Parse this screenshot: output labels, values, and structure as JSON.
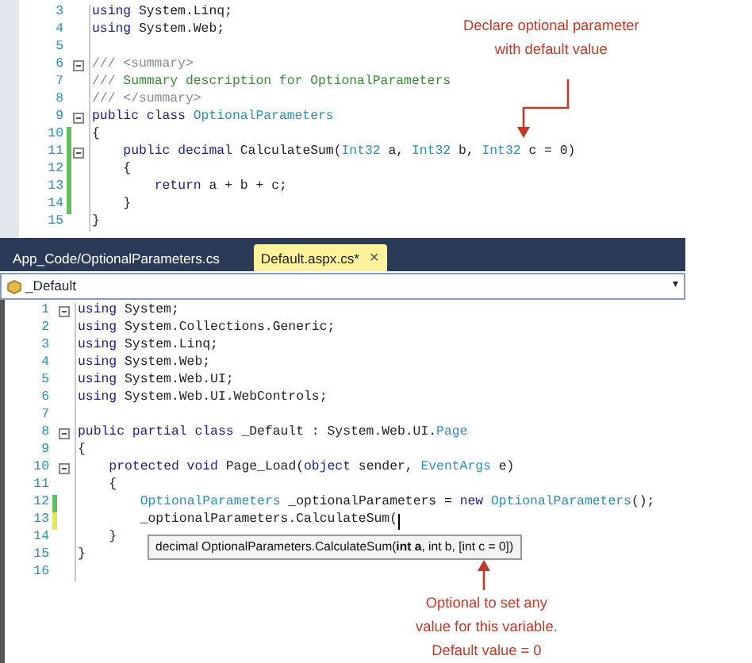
{
  "top_editor": {
    "lines": [
      {
        "number": "3",
        "segments": [
          {
            "kind": "kw",
            "text": "using"
          },
          {
            "kind": "plain",
            "text": " System.Linq;"
          }
        ]
      },
      {
        "number": "4",
        "segments": [
          {
            "kind": "kw",
            "text": "using"
          },
          {
            "kind": "plain",
            "text": " System.Web;"
          }
        ]
      },
      {
        "number": "5"
      },
      {
        "number": "6",
        "fold": true,
        "segments": [
          {
            "kind": "doc",
            "text": "/// <summary>"
          }
        ]
      },
      {
        "number": "7",
        "segments": [
          {
            "kind": "doc",
            "text": "///"
          },
          {
            "kind": "comment",
            "text": " Summary description for OptionalParameters"
          }
        ]
      },
      {
        "number": "8",
        "segments": [
          {
            "kind": "doc",
            "text": "/// </summary>"
          }
        ]
      },
      {
        "number": "9",
        "fold": true,
        "segments": [
          {
            "kind": "kw",
            "text": "public class"
          },
          {
            "kind": "type",
            "text": " OptionalParameters"
          }
        ]
      },
      {
        "number": "10",
        "modified": true,
        "saved": true,
        "segments": [
          {
            "kind": "plain",
            "text": "{"
          }
        ]
      },
      {
        "number": "11",
        "modified": true,
        "saved": true,
        "fold": true,
        "indented": true,
        "segments": [
          {
            "kind": "kw",
            "text": "public decimal"
          },
          {
            "kind": "plain",
            "text": " CalculateSum("
          },
          {
            "kind": "type",
            "text": "Int32"
          },
          {
            "kind": "plain",
            "text": " a, "
          },
          {
            "kind": "type",
            "text": "Int32"
          },
          {
            "kind": "plain",
            "text": " b, "
          },
          {
            "kind": "type",
            "text": "Int32"
          },
          {
            "kind": "plain",
            "text": " c = 0)"
          }
        ]
      },
      {
        "number": "12",
        "modified": true,
        "saved": true,
        "indented": true,
        "segments": [
          {
            "kind": "plain",
            "text": "{"
          }
        ]
      },
      {
        "number": "13",
        "modified": true,
        "saved": true,
        "indented": true,
        "deeper": true,
        "segments": [
          {
            "kind": "kw",
            "text": "return"
          },
          {
            "kind": "plain",
            "text": " a + b + c;"
          }
        ]
      },
      {
        "number": "14",
        "modified": true,
        "saved": true,
        "indented": true,
        "segments": [
          {
            "kind": "plain",
            "text": "}"
          }
        ]
      },
      {
        "number": "15",
        "segments": [
          {
            "kind": "plain",
            "text": "}"
          }
        ]
      }
    ]
  },
  "tabs": [
    {
      "label": "App_Code/OptionalParameters.cs",
      "selected": false
    },
    {
      "label": "Default.aspx.cs*",
      "selected": true,
      "close": "✕"
    }
  ],
  "member_dropdown": {
    "value": "_Default",
    "caret": "▾"
  },
  "bottom_editor": {
    "lines": [
      {
        "number": "1",
        "fold": true,
        "segments": [
          {
            "kind": "kw",
            "text": "using"
          },
          {
            "kind": "plain",
            "text": " System;"
          }
        ]
      },
      {
        "number": "2",
        "segments": [
          {
            "kind": "kw",
            "text": "using"
          },
          {
            "kind": "plain",
            "text": " System.Collections.Generic;"
          }
        ]
      },
      {
        "number": "3",
        "segments": [
          {
            "kind": "kw",
            "text": "using"
          },
          {
            "kind": "plain",
            "text": " System.Linq;"
          }
        ]
      },
      {
        "number": "4",
        "segments": [
          {
            "kind": "kw",
            "text": "using"
          },
          {
            "kind": "plain",
            "text": " System.Web;"
          }
        ]
      },
      {
        "number": "5",
        "segments": [
          {
            "kind": "kw",
            "text": "using"
          },
          {
            "kind": "plain",
            "text": " System.Web.UI;"
          }
        ]
      },
      {
        "number": "6",
        "segments": [
          {
            "kind": "kw",
            "text": "using"
          },
          {
            "kind": "plain",
            "text": " System.Web.UI.WebControls;"
          }
        ]
      },
      {
        "number": "7"
      },
      {
        "number": "8",
        "fold": true,
        "segments": [
          {
            "kind": "kw",
            "text": "public partial class"
          },
          {
            "kind": "plain",
            "text": " _Default : System.Web.UI."
          },
          {
            "kind": "type",
            "text": "Page"
          }
        ]
      },
      {
        "number": "9",
        "segments": [
          {
            "kind": "plain",
            "text": "{"
          }
        ]
      },
      {
        "number": "10",
        "fold": true,
        "indented": true,
        "segments": [
          {
            "kind": "kw",
            "text": "protected void"
          },
          {
            "kind": "plain",
            "text": " Page_Load("
          },
          {
            "kind": "kw",
            "text": "object"
          },
          {
            "kind": "plain",
            "text": " sender, "
          },
          {
            "kind": "type",
            "text": "EventArgs"
          },
          {
            "kind": "plain",
            "text": " e)"
          }
        ]
      },
      {
        "number": "11",
        "indented": true,
        "segments": [
          {
            "kind": "plain",
            "text": "{"
          }
        ]
      },
      {
        "number": "12",
        "modified": true,
        "saved": true,
        "indented": true,
        "deeper": true,
        "segments": [
          {
            "kind": "type",
            "text": "OptionalParameters"
          },
          {
            "kind": "plain",
            "text": " _optionalParameters = "
          },
          {
            "kind": "kw",
            "text": "new"
          },
          {
            "kind": "type",
            "text": " OptionalParameters"
          },
          {
            "kind": "plain",
            "text": "();"
          }
        ]
      },
      {
        "number": "13",
        "modified": true,
        "saved": false,
        "caret": true,
        "indented": true,
        "deeper": true,
        "segments": [
          {
            "kind": "plain",
            "text": "_optionalParameters.CalculateSum("
          }
        ]
      },
      {
        "number": "14",
        "indented": true,
        "segments": [
          {
            "kind": "plain",
            "text": "}"
          }
        ]
      },
      {
        "number": "15",
        "segments": [
          {
            "kind": "plain",
            "text": "}"
          }
        ]
      },
      {
        "number": "16"
      }
    ]
  },
  "tooltip": "decimal OptionalParameters.CalculateSum(**int a**, int b, [int c = 0])",
  "annotations": [
    {
      "lines": [
        "Declare optional parameter",
        "with default value"
      ]
    },
    {
      "lines": [
        "Optional to set any",
        "value for this variable.",
        "Default value = 0"
      ]
    }
  ]
}
